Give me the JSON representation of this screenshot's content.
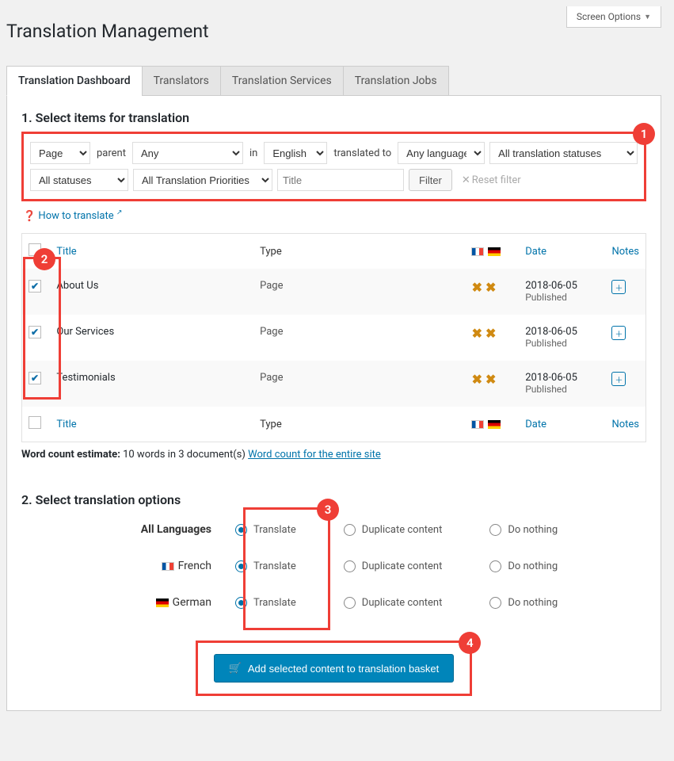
{
  "screen_options": "Screen Options",
  "page_title": "Translation Management",
  "tabs": [
    "Translation Dashboard",
    "Translators",
    "Translation Services",
    "Translation Jobs"
  ],
  "section1_title": "1. Select items for translation",
  "filters": {
    "type": "Page",
    "parent_label": "parent",
    "parent_value": "Any",
    "in_label": "in",
    "lang_from": "English",
    "to_label": "translated to",
    "lang_to": "Any language",
    "tr_status": "All translation statuses",
    "status": "All statuses",
    "priorities": "All Translation Priorities",
    "title_placeholder": "Title",
    "filter_btn": "Filter",
    "reset": "Reset filter"
  },
  "howto": "How to translate",
  "columns": {
    "title": "Title",
    "type": "Type",
    "date": "Date",
    "notes": "Notes"
  },
  "rows": [
    {
      "title": "About Us",
      "type": "Page",
      "date": "2018-06-05",
      "status": "Published"
    },
    {
      "title": "Our Services",
      "type": "Page",
      "date": "2018-06-05",
      "status": "Published"
    },
    {
      "title": "Testimonials",
      "type": "Page",
      "date": "2018-06-05",
      "status": "Published"
    }
  ],
  "wordcount": {
    "label": "Word count estimate:",
    "text": "10 words in 3 document(s)",
    "link": "Word count for the entire site"
  },
  "section2_title": "2. Select translation options",
  "opt_labels": {
    "all": "All Languages",
    "french": "French",
    "german": "German",
    "translate": "Translate",
    "duplicate": "Duplicate content",
    "nothing": "Do nothing"
  },
  "basket_btn": "Add selected content to translation basket",
  "callouts": {
    "c1": "1",
    "c2": "2",
    "c3": "3",
    "c4": "4"
  }
}
